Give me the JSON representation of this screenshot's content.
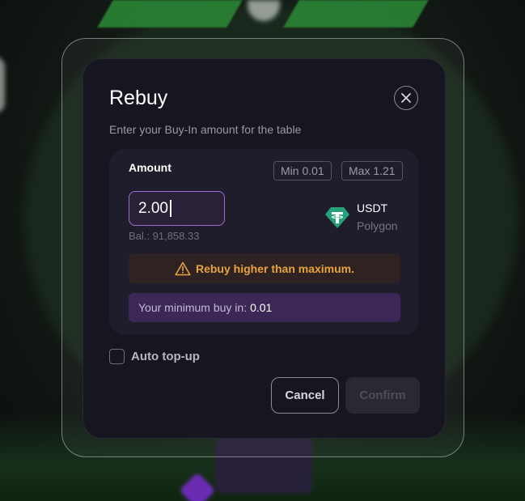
{
  "dialog": {
    "title": "Rebuy",
    "subtitle": "Enter your Buy-In amount for the table",
    "amount_label": "Amount",
    "min_chip": "Min 0.01",
    "max_chip": "Max 1.21",
    "amount_value": "2.00",
    "balance": "Bal.: 91,858.33",
    "currency": "USDT",
    "network": "Polygon",
    "warning": "Rebuy higher than maximum.",
    "min_buyin_label": "Your minimum buy in:",
    "min_buyin_value": "0.01",
    "auto_topup_label": "Auto top-up",
    "auto_topup_checked": false,
    "cancel_label": "Cancel",
    "confirm_label": "Confirm",
    "confirm_enabled": false
  },
  "icons": {
    "close": "close-icon",
    "currency": "usdt-tether-icon",
    "warning": "warning-triangle-icon"
  },
  "colors": {
    "modal_bg": "#161620",
    "panel_bg": "#1f1d2b",
    "input_border": "#9b6bd6",
    "warning_text": "#e8a33a",
    "warning_bg": "#2e2322",
    "min_buyin_bg": "#3c2857",
    "tether_green": "#26a17b"
  }
}
